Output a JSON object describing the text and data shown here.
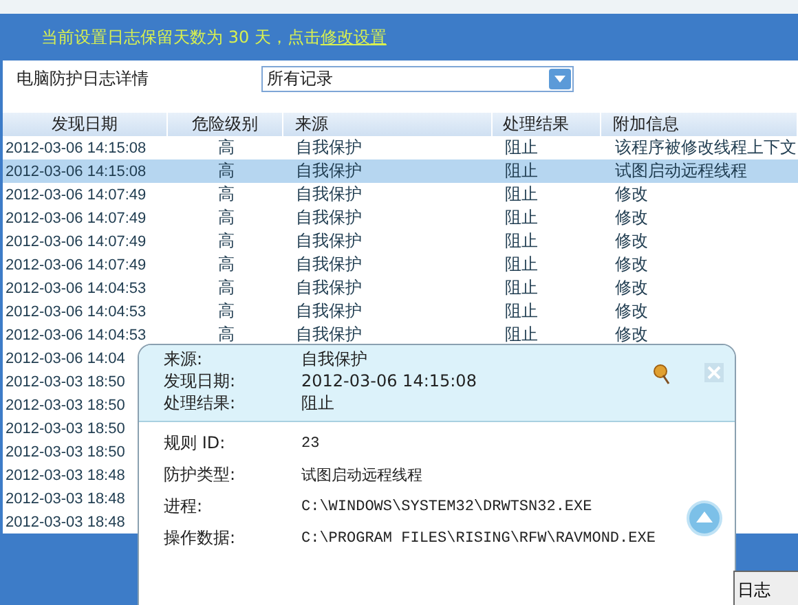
{
  "notice": {
    "text": "当前设置日志保留天数为 30 天，点击",
    "link": "修改设置"
  },
  "filter": {
    "label": "电脑防护日志详情",
    "value": "所有记录"
  },
  "table": {
    "columns": [
      "发现日期",
      "危险级别",
      "来源",
      "处理结果",
      "附加信息"
    ],
    "rows": [
      {
        "selected": false,
        "cells": [
          "2012-03-06 14:15:08",
          "高",
          "自我保护",
          "阻止",
          "该程序被修改线程上下文"
        ]
      },
      {
        "selected": true,
        "cells": [
          "2012-03-06 14:15:08",
          "高",
          "自我保护",
          "阻止",
          "试图启动远程线程"
        ]
      },
      {
        "selected": false,
        "cells": [
          "2012-03-06 14:07:49",
          "高",
          "自我保护",
          "阻止",
          "修改"
        ]
      },
      {
        "selected": false,
        "cells": [
          "2012-03-06 14:07:49",
          "高",
          "自我保护",
          "阻止",
          "修改"
        ]
      },
      {
        "selected": false,
        "cells": [
          "2012-03-06 14:07:49",
          "高",
          "自我保护",
          "阻止",
          "修改"
        ]
      },
      {
        "selected": false,
        "cells": [
          "2012-03-06 14:07:49",
          "高",
          "自我保护",
          "阻止",
          "修改"
        ]
      },
      {
        "selected": false,
        "cells": [
          "2012-03-06 14:04:53",
          "高",
          "自我保护",
          "阻止",
          "修改"
        ]
      },
      {
        "selected": false,
        "cells": [
          "2012-03-06 14:04:53",
          "高",
          "自我保护",
          "阻止",
          "修改"
        ]
      },
      {
        "selected": false,
        "cells": [
          "2012-03-06 14:04:53",
          "高",
          "自我保护",
          "阻止",
          "修改"
        ]
      },
      {
        "selected": false,
        "cells": [
          "2012-03-06 14:04"
        ]
      },
      {
        "selected": false,
        "cells": [
          "2012-03-03 18:50"
        ]
      },
      {
        "selected": false,
        "cells": [
          "2012-03-03 18:50"
        ]
      },
      {
        "selected": false,
        "cells": [
          "2012-03-03 18:50"
        ]
      },
      {
        "selected": false,
        "cells": [
          "2012-03-03 18:50"
        ]
      },
      {
        "selected": false,
        "cells": [
          "2012-03-03 18:48"
        ]
      },
      {
        "selected": false,
        "cells": [
          "2012-03-03 18:48"
        ]
      },
      {
        "selected": false,
        "cells": [
          "2012-03-03 18:48"
        ]
      }
    ]
  },
  "popup": {
    "header": [
      {
        "label": "来源:",
        "value": "自我保护"
      },
      {
        "label": "发现日期:",
        "value": "2012-03-06 14:15:08"
      },
      {
        "label": "处理结果:",
        "value": "阻止"
      }
    ],
    "details": [
      {
        "label": "规则 ID:",
        "value": "23"
      },
      {
        "label": "防护类型:",
        "value": "试图启动远程线程"
      },
      {
        "label": "进程:",
        "value": "C:\\WINDOWS\\SYSTEM32\\DRWTSN32.EXE"
      },
      {
        "label": "操作数据:",
        "value": "C:\\PROGRAM FILES\\RISING\\RFW\\RAVMOND.EXE"
      }
    ]
  },
  "log_button": "日志"
}
